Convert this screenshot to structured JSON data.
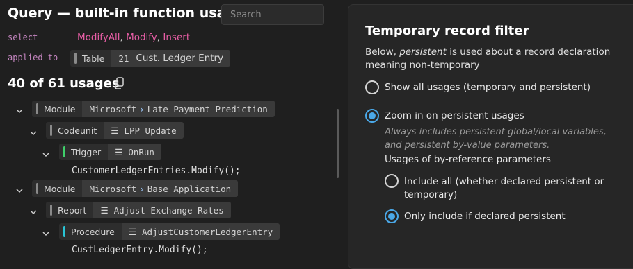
{
  "query": {
    "title": "Query — built-in function usages",
    "search_placeholder": "Search",
    "select_keyword": "select",
    "functions": [
      "ModifyAll",
      "Modify",
      "Insert"
    ],
    "applied_keyword": "applied to",
    "applied_to": {
      "kind": "Table",
      "id": "21",
      "name": "Cust. Ledger Entry"
    },
    "usage_count": "40 of 61 usages"
  },
  "tree": {
    "node1": {
      "kind": "Module",
      "publisher": "Microsoft",
      "name": "Late Payment Prediction"
    },
    "node1_child": {
      "kind": "Codeunit",
      "name": "LPP Update"
    },
    "node1_grandchild": {
      "kind": "Trigger",
      "name": "OnRun",
      "code": "CustomerLedgerEntries.Modify();"
    },
    "node2": {
      "kind": "Module",
      "publisher": "Microsoft",
      "name": "Base Application"
    },
    "node2_child": {
      "kind": "Report",
      "name": "Adjust Exchange Rates"
    },
    "node2_grandchild": {
      "kind": "Procedure",
      "name": "AdjustCustomerLedgerEntry",
      "code": "CustLedgerEntry.Modify();"
    }
  },
  "filter_panel": {
    "title": "Temporary record filter",
    "desc_before": "Below, ",
    "desc_em": "persistent",
    "desc_after": " is used about a record declaration meaning non-temporary",
    "option_all": "Show all usages (temporary and persistent)",
    "option_zoom": "Zoom in on persistent usages",
    "zoom_note": "Always includes persistent global/local variables, and persistent by-value parameters.",
    "byref_label": "Usages of by-reference parameters",
    "byref_include_all": "Include all (whether declared persistent or temporary)",
    "byref_only_persistent": "Only include if declared persistent",
    "selected_option": "Zoom in on persistent usages",
    "selected_byref": "Only include if declared persistent",
    "accent_color": "#4aa8e8"
  },
  "colors": {
    "function_link": "#e85ea6",
    "keyword": "#c586c0",
    "trigger_bar": "#3fcf6a",
    "procedure_bar": "#29c5d6"
  }
}
